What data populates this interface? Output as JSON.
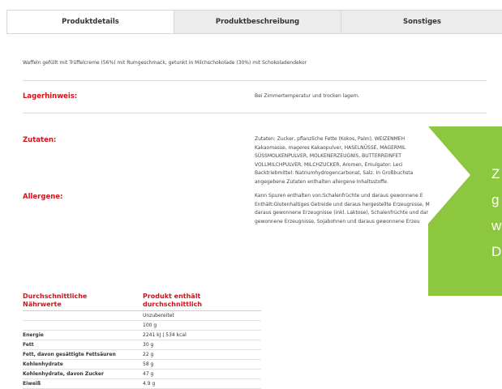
{
  "tabs": [
    {
      "label": "Produktdetails",
      "active": true
    },
    {
      "label": "Produktbeschreibung",
      "active": false
    },
    {
      "label": "Sonstiges",
      "active": false
    }
  ],
  "description": "Waffeln gefüllt mit Trüffelcreme (56%) mit Rumgeschmack, getunkt in Milchschokolade (30%) mit Schokoladendekor",
  "storage": {
    "label": "Lagerhinweis:",
    "value": "Bei Zimmertemperatur und trocken lagern."
  },
  "ingredients": {
    "label": "Zutaten:",
    "lines": [
      "Zutaten: Zucker, pflanzliche Fette (Kokos, Palm), WEIZENMEH",
      "Kakaomasse, mageres Kakaopulver, HASELNÜSSE, MAGERMIL",
      "SÜSSMOLKENPULVER, MOLKENERZEUGNIS, BUTTERREINFET",
      "VOLLMILCHPULVER, MILCHZUCKER, Aromen, Emulgator: Leci",
      "Backtriebmittel: Natriumhydrogencarbonat, Salz. In Großbuchsta",
      "angegebene Zutaten enthalten allergene Inhaltsstoffe."
    ]
  },
  "allergens": {
    "label": "Allergene:",
    "lines": [
      "Kann Spuren enthalten von:Schalenfrüchte und daraus gewonnene E",
      "Enthält:Glutenhaltiges Getreide und daraus hergestellte Erzeugnisse, M",
      "daraus gewonnene Erzeugnisse (inkl. Laktose), Schalenfrüchte und dar",
      "gewonnene Erzeugnisse, Sojabohnen und daraus gewonnene Erzeu"
    ]
  },
  "nutrition": {
    "header_left_1": "Durchschnittliche",
    "header_left_2": "Nährwerte",
    "header_right_1": "Produkt enthält",
    "header_right_2": "durchschnittlich",
    "rows": [
      {
        "name": "",
        "value": "Unzubereitet"
      },
      {
        "name": "",
        "value": "100 g"
      },
      {
        "name": "Energie",
        "value": "2241 kJ | 534 kcal"
      },
      {
        "name": "Fett",
        "value": "30 g"
      },
      {
        "name": "Fett, davon gesättigte Fettsäuren",
        "value": "22 g"
      },
      {
        "name": "Kohlenhydrate",
        "value": "58 g"
      },
      {
        "name": "Kohlenhydrate, davon Zucker",
        "value": "47 g"
      },
      {
        "name": "Eiweiß",
        "value": "4.9 g"
      }
    ]
  },
  "promo": {
    "color": "#8dc63f",
    "letters": [
      "Z",
      "g",
      "w",
      "D"
    ]
  }
}
